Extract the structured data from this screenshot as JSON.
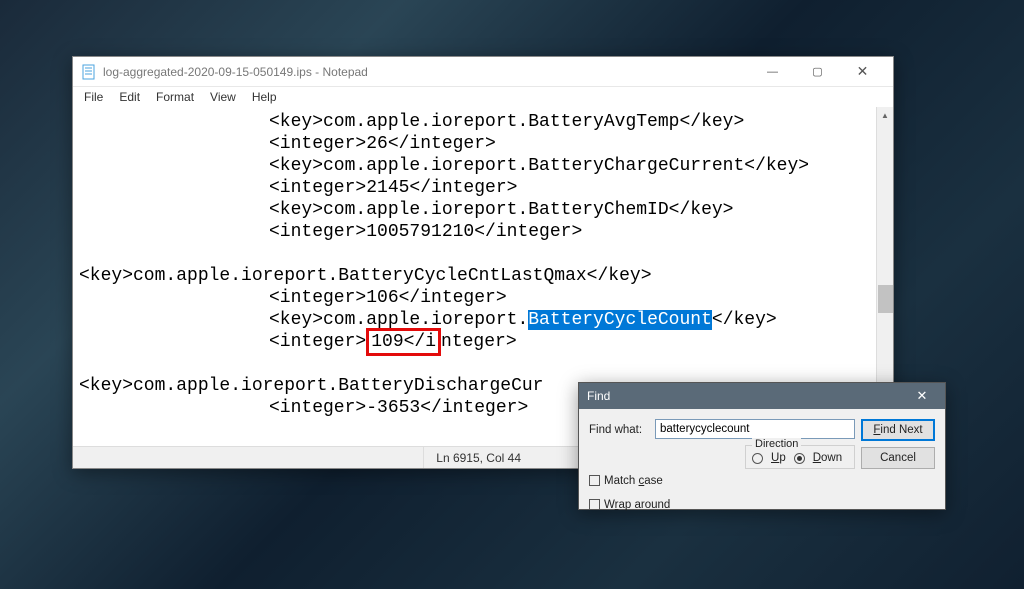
{
  "window": {
    "title": "log-aggregated-2020-09-15-050149.ips - Notepad",
    "min_label": "—",
    "max_label": "▢",
    "close_label": "✕"
  },
  "menu": {
    "file": "File",
    "edit": "Edit",
    "format": "Format",
    "view": "View",
    "help": "Help"
  },
  "content": {
    "l1a": "<key>com.apple.ioreport.BatteryAvgTemp</key>",
    "l2a": "<integer>26</integer>",
    "l3a": "<key>com.apple.ioreport.BatteryChargeCurrent</key>",
    "l4a": "<integer>2145</integer>",
    "l5a": "<key>com.apple.ioreport.BatteryChemID</key>",
    "l6a": "<integer>1005791210</integer>",
    "l7": "",
    "l8": "<key>com.apple.ioreport.BatteryCycleCntLastQmax</key>",
    "l9a": "<integer>106</integer>",
    "l10a": "<key>com.apple.ioreport.",
    "l10sel": "BatteryCycleCount",
    "l10b": "</key>",
    "l11a": "<integer>",
    "l11box": "109</i",
    "l11b": "nteger>",
    "l12": "",
    "l13": "<key>com.apple.ioreport.BatteryDischargeCur",
    "l14a": "<integer>-3653</integer>"
  },
  "status": {
    "pos": "Ln 6915, Col 44"
  },
  "find": {
    "title": "Find",
    "close": "✕",
    "label": "Find what:",
    "value": "batterycyclecount",
    "next": "Find Next",
    "cancel": "Cancel",
    "direction": "Direction",
    "up": "Up",
    "down": "Down",
    "matchcase": "Match case",
    "wrap": "Wrap around"
  }
}
